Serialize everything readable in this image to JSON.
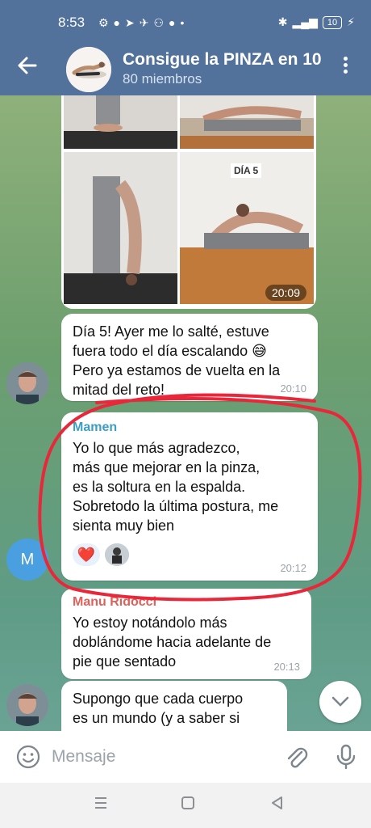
{
  "status": {
    "time": "8:53",
    "battery": "10"
  },
  "header": {
    "title": "Consigue la PINZA en 10",
    "subtitle": "80 miembros"
  },
  "album": {
    "label": "DÍA 5",
    "time": "20:09"
  },
  "messages": [
    {
      "id": "m1",
      "sender": "",
      "lines": [
        "Día 5! Ayer me lo salté, estuve",
        "fuera todo el día escalando 😅",
        "Pero ya estamos de vuelta en la",
        "mitad del reto!"
      ],
      "time": "20:10"
    },
    {
      "id": "m2",
      "sender": "Mamen",
      "lines": [
        "Yo lo que más agradezco,",
        "más que mejorar en la pinza,",
        "es la soltura en la espalda.",
        "Sobretodo la última postura, me",
        "sienta muy bien"
      ],
      "time": "20:12",
      "reaction": "❤️"
    },
    {
      "id": "m3",
      "sender": "Manu Ridocci",
      "lines": [
        "Yo estoy notándolo más",
        "doblándome hacia adelante de",
        "pie que sentado"
      ],
      "time": "20:13"
    },
    {
      "id": "m4",
      "sender": "",
      "lines": [
        "Supongo que cada cuerpo",
        "es un mundo (y a saber si"
      ],
      "time": ""
    }
  ],
  "avatars": {
    "mamen_initial": "M"
  },
  "composer": {
    "placeholder": "Mensaje"
  },
  "colors": {
    "header": "#52729b",
    "mamen_name": "#3a9fc4",
    "manu_name": "#e0605a",
    "annotation": "#e8283a"
  },
  "icons": [
    "back-arrow-icon",
    "menu-dots-icon",
    "emoji-icon",
    "attach-icon",
    "mic-icon",
    "chevron-down-icon",
    "nav-recents-icon",
    "nav-home-icon",
    "nav-back-icon"
  ]
}
